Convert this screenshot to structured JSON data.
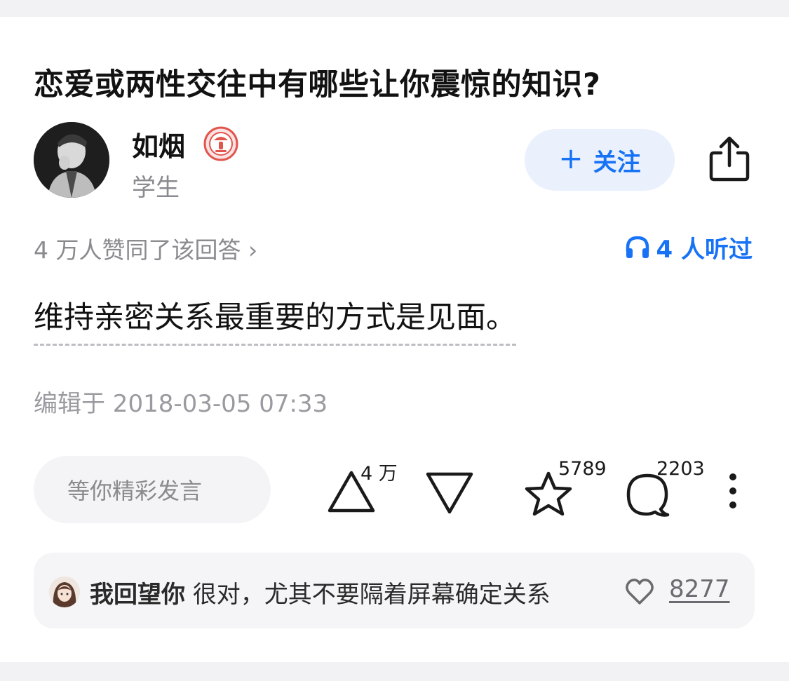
{
  "question": {
    "title": "恋爱或两性交往中有哪些让你震惊的知识?"
  },
  "author": {
    "name": "如烟",
    "bio": "学生",
    "avatar_icon": "user-portrait-icon",
    "badge_icon": "microphone-badge-icon"
  },
  "follow": {
    "plus": "+",
    "label": "关注"
  },
  "meta": {
    "upvote_summary": "4 万人赞同了该回答 ›",
    "listened": "4 人听过"
  },
  "answer": {
    "text": "维持亲密关系最重要的方式是见面。"
  },
  "edited": "编辑于 2018-03-05 07:33",
  "comment_input": {
    "placeholder": "等你精彩发言"
  },
  "actions": {
    "upvote_count": "4 万",
    "favorite_count": "5789",
    "comment_count": "2203"
  },
  "hot_comment": {
    "username": "我回望你",
    "text": "很对，尤其不要隔着屏幕确定关系",
    "like_count": "8277"
  },
  "colors": {
    "accent": "#1772f6",
    "follow_bg": "#eaf1fd",
    "muted": "#8a8a8f"
  }
}
